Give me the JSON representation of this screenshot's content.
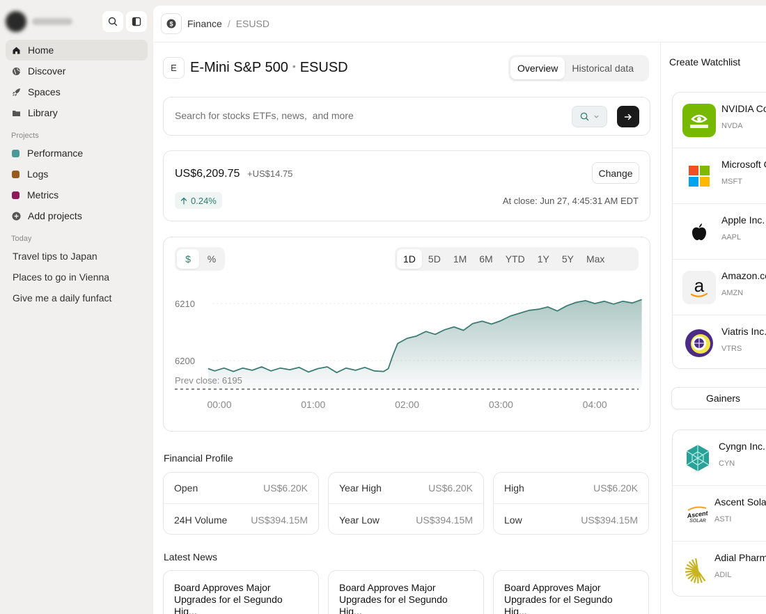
{
  "sidebar": {
    "nav": [
      {
        "label": "Home",
        "icon": "home-icon"
      },
      {
        "label": "Discover",
        "icon": "globe-icon"
      },
      {
        "label": "Spaces",
        "icon": "rocket-icon"
      },
      {
        "label": "Library",
        "icon": "folder-icon"
      }
    ],
    "projects_title": "Projects",
    "projects": [
      {
        "label": "Performance",
        "color": "#4a9a97"
      },
      {
        "label": "Logs",
        "color": "#9a5a1e"
      },
      {
        "label": "Metrics",
        "color": "#8e1a5c"
      }
    ],
    "add_projects": "Add projects",
    "today_title": "Today",
    "today": [
      "Travel tips to Japan",
      "Places to go in Vienna",
      "Give me a daily funfact"
    ]
  },
  "breadcrumb": {
    "root": "Finance",
    "separator": "/",
    "current": "ESUSD"
  },
  "header": {
    "badge": "E",
    "name": "E-Mini S&P 500",
    "dot": "•",
    "symbol": "ESUSD",
    "tabs": [
      "Overview",
      "Historical data"
    ]
  },
  "search": {
    "placeholder": "Search for stocks ETFs, news,  and more"
  },
  "quote": {
    "price": "US$6,209.75",
    "delta": "+US$14.75",
    "percent": "0.24%",
    "change_label": "Change",
    "close_info": "At close: Jun 27, 4:45:31 AM EDT"
  },
  "chart_controls": {
    "units": [
      "$",
      "%"
    ],
    "ranges": [
      "1D",
      "5D",
      "1M",
      "6M",
      "YTD",
      "1Y",
      "5Y",
      "Max"
    ]
  },
  "chart_data": {
    "type": "area",
    "xlabel": "",
    "ylabel": "",
    "x_ticks": [
      "00:00",
      "01:00",
      "02:00",
      "03:00",
      "04:00"
    ],
    "y_ticks": [
      6200,
      6210
    ],
    "reference": {
      "label": "Prev close: 6195",
      "value": 6195
    },
    "color": "#3d7c74",
    "x_range": [
      "-0.15",
      "4.5"
    ],
    "series": [
      {
        "x": [
          -0.12,
          -0.05,
          0.05,
          0.15,
          0.25,
          0.35,
          0.45,
          0.55,
          0.65,
          0.75,
          0.85,
          0.95,
          1.05,
          1.15,
          1.25,
          1.35,
          1.45,
          1.55,
          1.65,
          1.75,
          1.8,
          1.85,
          1.9,
          2.0,
          2.1,
          2.2,
          2.3,
          2.4,
          2.5,
          2.6,
          2.7,
          2.8,
          2.9,
          3.0,
          3.1,
          3.2,
          3.3,
          3.4,
          3.5,
          3.6,
          3.7,
          3.8,
          3.9,
          4.0,
          4.1,
          4.2,
          4.3,
          4.4,
          4.5
        ],
        "values": [
          6198.6,
          6198.2,
          6198.7,
          6198.1,
          6198.7,
          6198.3,
          6198.9,
          6198.2,
          6198.7,
          6198.4,
          6198.8,
          6198.0,
          6198.6,
          6198.9,
          6197.9,
          6198.7,
          6198.3,
          6198.8,
          6198.2,
          6198.1,
          6198.6,
          6201.0,
          6203.0,
          6203.9,
          6204.3,
          6205.1,
          6204.6,
          6205.4,
          6205.9,
          6205.3,
          6206.5,
          6206.9,
          6206.4,
          6207.0,
          6207.8,
          6208.3,
          6208.8,
          6209.0,
          6209.4,
          6208.7,
          6209.6,
          6210.2,
          6210.5,
          6210.0,
          6210.4,
          6209.9,
          6210.4,
          6210.1,
          6210.7
        ]
      }
    ]
  },
  "financial_profile": {
    "title": "Financial Profile",
    "cards": [
      {
        "k1": "Open",
        "v1": "US$6.20K",
        "k2": "24H Volume",
        "v2": "US$394.15M"
      },
      {
        "k1": "Year High",
        "v1": "US$6.20K",
        "k2": "Year Low",
        "v2": "US$394.15M"
      },
      {
        "k1": "High",
        "v1": "US$6.20K",
        "k2": "Low",
        "v2": "US$394.15M"
      }
    ]
  },
  "latest_news": {
    "title": "Latest News",
    "items": [
      {
        "line1": "Board Approves Major",
        "line2": "Upgrades for el Segundo Hig..."
      },
      {
        "line1": "Board Approves Major",
        "line2": "Upgrades for el Segundo Hig..."
      },
      {
        "line1": "Board Approves Major",
        "line2": "Upgrades for el Segundo Hig..."
      }
    ]
  },
  "watchlist": {
    "title": "Create Watchlist",
    "items": [
      {
        "name": "NVIDIA Co",
        "ticker": "NVDA",
        "logo": "nvidia-logo"
      },
      {
        "name": "Microsoft C",
        "ticker": "MSFT",
        "logo": "microsoft-logo"
      },
      {
        "name": "Apple Inc.",
        "ticker": "AAPL",
        "logo": "apple-logo"
      },
      {
        "name": "Amazon.co",
        "ticker": "AMZN",
        "logo": "amazon-logo"
      },
      {
        "name": "Viatris Inc.",
        "ticker": "VTRS",
        "logo": "viatris-logo"
      }
    ]
  },
  "gainers": {
    "label": "Gainers",
    "items": [
      {
        "name": "Cyngn Inc.",
        "ticker": "CYN",
        "logo": "cyngn-logo"
      },
      {
        "name": "Ascent Sola",
        "ticker": "ASTI",
        "logo": "ascent-logo",
        "logo_text": "Ascent SOLAR"
      },
      {
        "name": "Adial Pharm",
        "ticker": "ADIL",
        "logo": "adial-logo"
      }
    ]
  }
}
